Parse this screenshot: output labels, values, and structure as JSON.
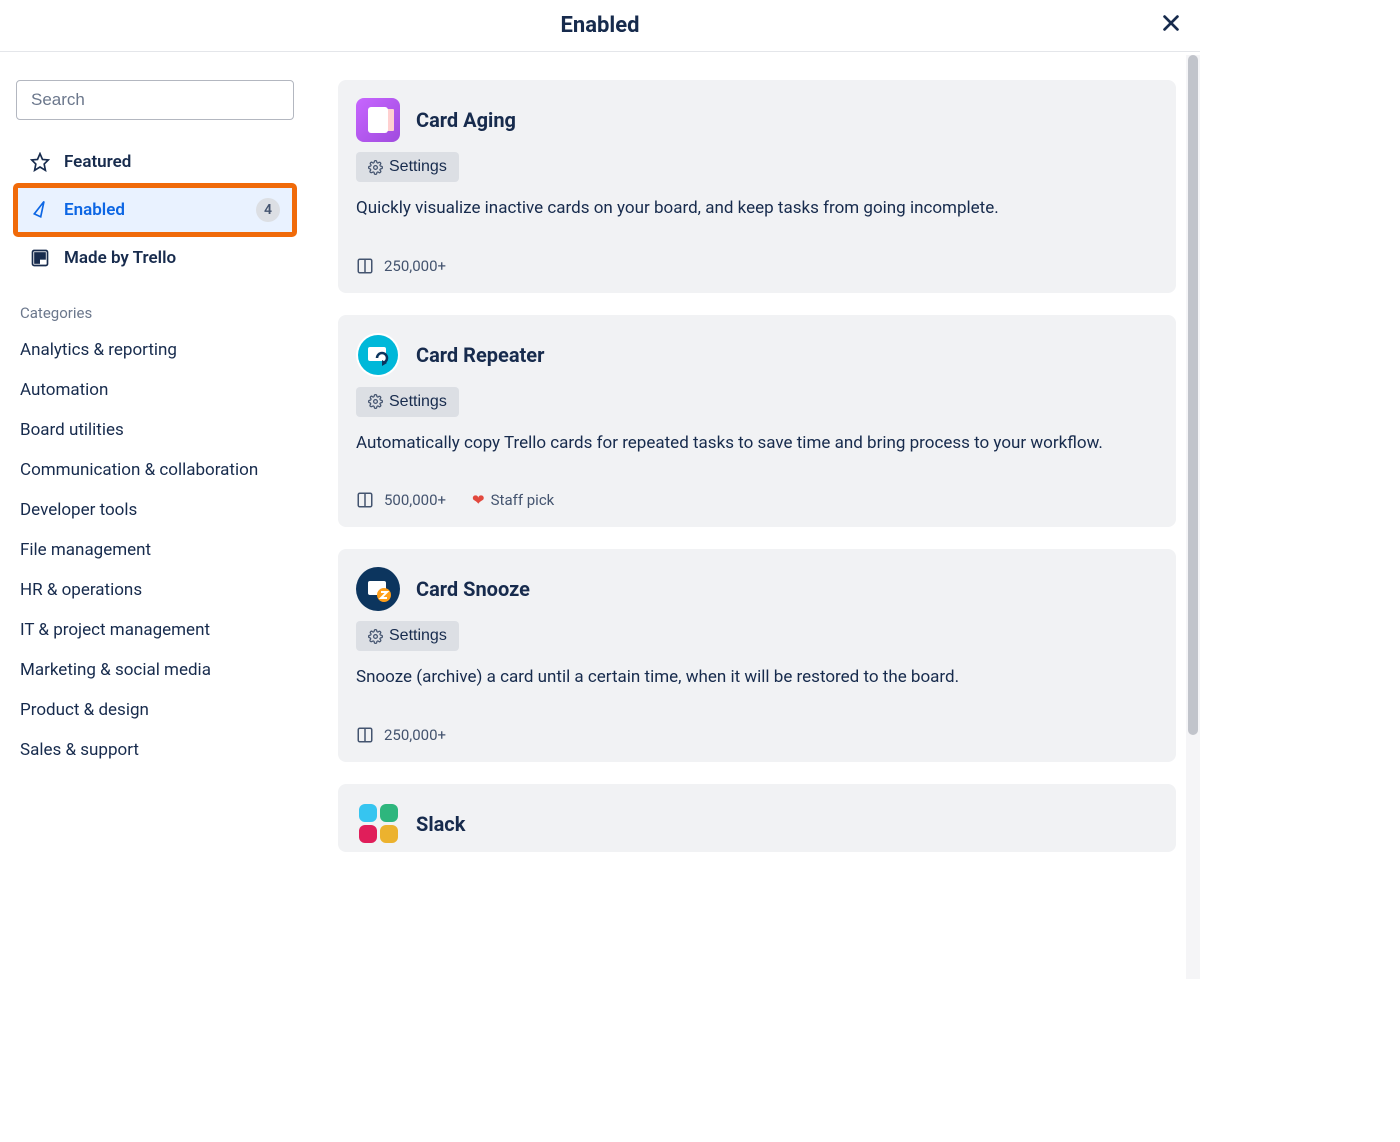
{
  "header": {
    "title": "Enabled"
  },
  "search": {
    "placeholder": "Search"
  },
  "nav": {
    "featured": "Featured",
    "enabled": "Enabled",
    "enabled_count": "4",
    "made_by": "Made by Trello"
  },
  "categories_heading": "Categories",
  "categories": [
    "Analytics & reporting",
    "Automation",
    "Board utilities",
    "Communication & collaboration",
    "Developer tools",
    "File management",
    "HR & operations",
    "IT & project management",
    "Marketing & social media",
    "Product & design",
    "Sales & support"
  ],
  "settings_label": "Settings",
  "staff_pick_label": "Staff pick",
  "powerups": [
    {
      "title": "Card Aging",
      "desc": "Quickly visualize inactive cards on your board, and keep tasks from going incomplete.",
      "installs": "250,000+",
      "staff_pick": false
    },
    {
      "title": "Card Repeater",
      "desc": "Automatically copy Trello cards for repeated tasks to save time and bring process to your workflow.",
      "installs": "500,000+",
      "staff_pick": true
    },
    {
      "title": "Card Snooze",
      "desc": "Snooze (archive) a card until a certain time, when it will be restored to the board.",
      "installs": "250,000+",
      "staff_pick": false
    },
    {
      "title": "Slack",
      "desc": "",
      "installs": "",
      "staff_pick": false
    }
  ]
}
